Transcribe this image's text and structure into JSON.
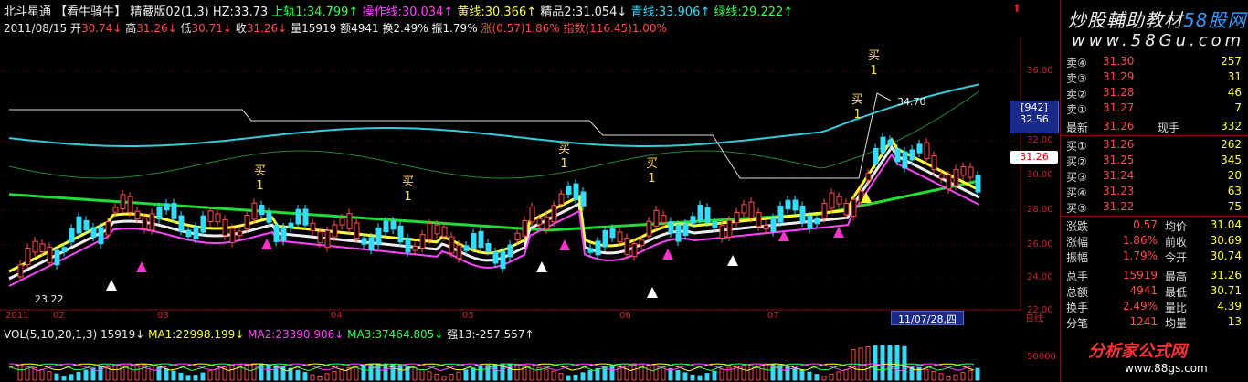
{
  "header": {
    "title": "北斗星通",
    "view_name": "【看牛骑牛】",
    "version": "精藏版02(1,3)",
    "hz_label": "HZ:33.73",
    "indicators": [
      {
        "label": "上轨1:34.799",
        "color": "#33ff55"
      },
      {
        "label": "操作线:30.034",
        "color": "#ff44ff"
      },
      {
        "label": "黄线:30.366",
        "color": "#ffff33"
      },
      {
        "label": "精品2:31.054",
        "color": "#eeeeee"
      },
      {
        "label": "青线:33.906",
        "color": "#33ddff"
      },
      {
        "label": "绿线:29.222",
        "color": "#33ff55"
      }
    ],
    "arrows": [
      "↑",
      "↑",
      "↑",
      "↓",
      "↑",
      "↑"
    ]
  },
  "quote": {
    "date": "2011/08/15",
    "open_label": "开",
    "open": "30.74",
    "high_label": "高",
    "high": "31.26",
    "low_label": "低",
    "low": "30.71",
    "close_label": "收",
    "close": "31.26",
    "volume_label": "量",
    "volume": "15919",
    "amount_label": "额",
    "amount": "4941",
    "turnover_label": "换",
    "turnover": "2.49%",
    "amplitude_label": "振",
    "amplitude": "1.79%",
    "change_label": "涨",
    "change": "(0.57)1.86%",
    "index_label": "指数",
    "index": "(116.45)1.00%"
  },
  "annotations": {
    "buy_label": "买",
    "buy_sub": "1",
    "high_marker": "34.70",
    "low_marker": "23.22"
  },
  "axis": {
    "ticks": [
      "36.00",
      "32.00",
      "30.00",
      "28.00",
      "26.00",
      "24.00",
      "22.00"
    ],
    "months": [
      "2011",
      "02",
      "03",
      "04",
      "05",
      "06",
      "07"
    ],
    "date_cursor": "11/07/28,四",
    "period": "日线",
    "cursor_box_top": "[942]",
    "cursor_box_value": "32.56",
    "last_price": "31.26",
    "vol_tick": "50000"
  },
  "volume_header": {
    "name": "VOL(5,10,20,1,3)",
    "value": "15919",
    "ma1": "MA1:22998.199",
    "ma2": "MA2:23390.906",
    "ma3": "MA3:37464.805",
    "strength": "强13:-257.557"
  },
  "panel": {
    "banner": "炒股輔助教材",
    "banner_brand": "58股网",
    "site": "www.58Gu.com",
    "sell": [
      {
        "label": "卖④",
        "price": "31.30",
        "vol": "257"
      },
      {
        "label": "卖③",
        "price": "31.29",
        "vol": "31"
      },
      {
        "label": "卖②",
        "price": "31.28",
        "vol": "46"
      },
      {
        "label": "卖①",
        "price": "31.27",
        "vol": "7"
      }
    ],
    "latest": {
      "label": "最新",
      "price": "31.26",
      "label2": "现手",
      "vol": "332"
    },
    "buy": [
      {
        "label": "买①",
        "price": "31.26",
        "vol": "262"
      },
      {
        "label": "买②",
        "price": "31.25",
        "vol": "345"
      },
      {
        "label": "买③",
        "price": "31.24",
        "vol": "20"
      },
      {
        "label": "买④",
        "price": "31.23",
        "vol": "63"
      },
      {
        "label": "买⑤",
        "price": "31.22",
        "vol": "75"
      }
    ],
    "stats": [
      {
        "l1": "涨跌",
        "v1": "0.57",
        "l2": "均价",
        "v2": "31.04"
      },
      {
        "l1": "涨幅",
        "v1": "1.86%",
        "l2": "前收",
        "v2": "30.69"
      },
      {
        "l1": "振幅",
        "v1": "1.79%",
        "l2": "今开",
        "v2": "30.74"
      },
      {
        "l1": "总手",
        "v1": "15919",
        "l2": "最高",
        "v2": "31.26"
      },
      {
        "l1": "总额",
        "v1": "4941",
        "l2": "最低",
        "v2": "30.71"
      },
      {
        "l1": "换手",
        "v1": "2.49%",
        "l2": "量比",
        "v2": "4.39"
      },
      {
        "l1": "分笔",
        "v1": "1241",
        "l2": "均量",
        "v2": "13"
      }
    ],
    "logo": "分析家公式网",
    "logo_url": "www.88gs.com"
  }
}
